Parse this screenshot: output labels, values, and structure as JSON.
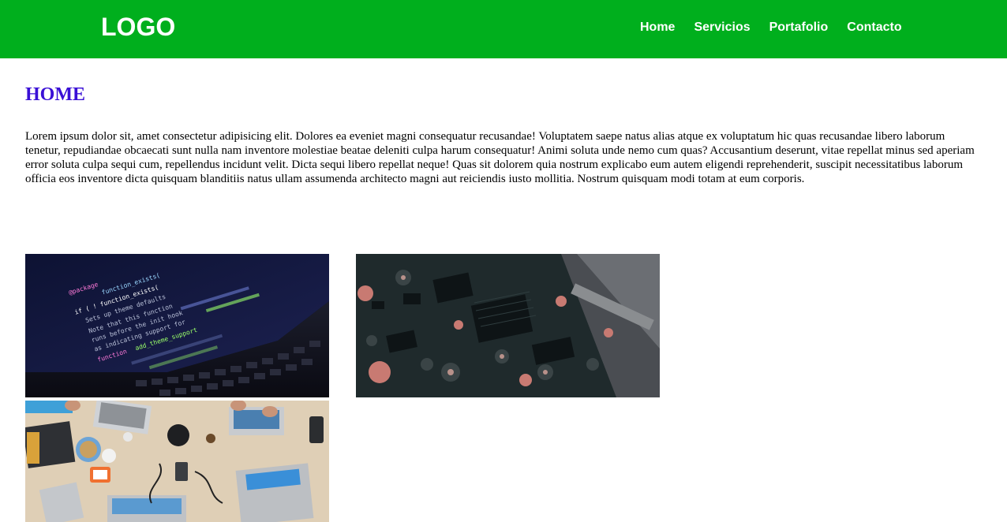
{
  "header": {
    "logo": "LOGO",
    "nav": [
      "Home",
      "Servicios",
      "Portafolio",
      "Contacto"
    ],
    "background": "#00af1d"
  },
  "main": {
    "title": "HOME",
    "title_color": "#3a10d6",
    "paragraph": "Lorem ipsum dolor sit, amet consectetur adipisicing elit. Dolores ea eveniet magni consequatur recusandae! Voluptatem saepe natus alias atque ex voluptatum hic quas recusandae libero laborum tenetur, repudiandae obcaecati sunt nulla nam inventore molestiae beatae deleniti culpa harum consequatur! Animi soluta unde nemo cum quas? Accusantium deserunt, vitae repellat minus sed aperiam error soluta culpa sequi cum, repellendus incidunt velit. Dicta sequi libero repellat neque! Quas sit dolorem quia nostrum explicabo eum autem eligendi reprehenderit, suscipit necessitatibus laborum officia eos inventore dicta quisquam blanditiis natus ullam assumenda architecto magni aut reiciendis iusto mollitia. Nostrum quisquam modi totam at eum corporis."
  },
  "gallery": {
    "images": [
      {
        "name": "code-laptop-photo",
        "code_text": [
          "@package",
          "function_exists(",
          "if ( ! function_exists(",
          "Sets up theme defaults",
          "Note that this function",
          "runs before the init hook",
          "as indicating support for",
          "function",
          "add_theme_support"
        ]
      },
      {
        "name": "circuit-board-photo"
      },
      {
        "name": "team-laptops-desk-photo"
      }
    ]
  }
}
